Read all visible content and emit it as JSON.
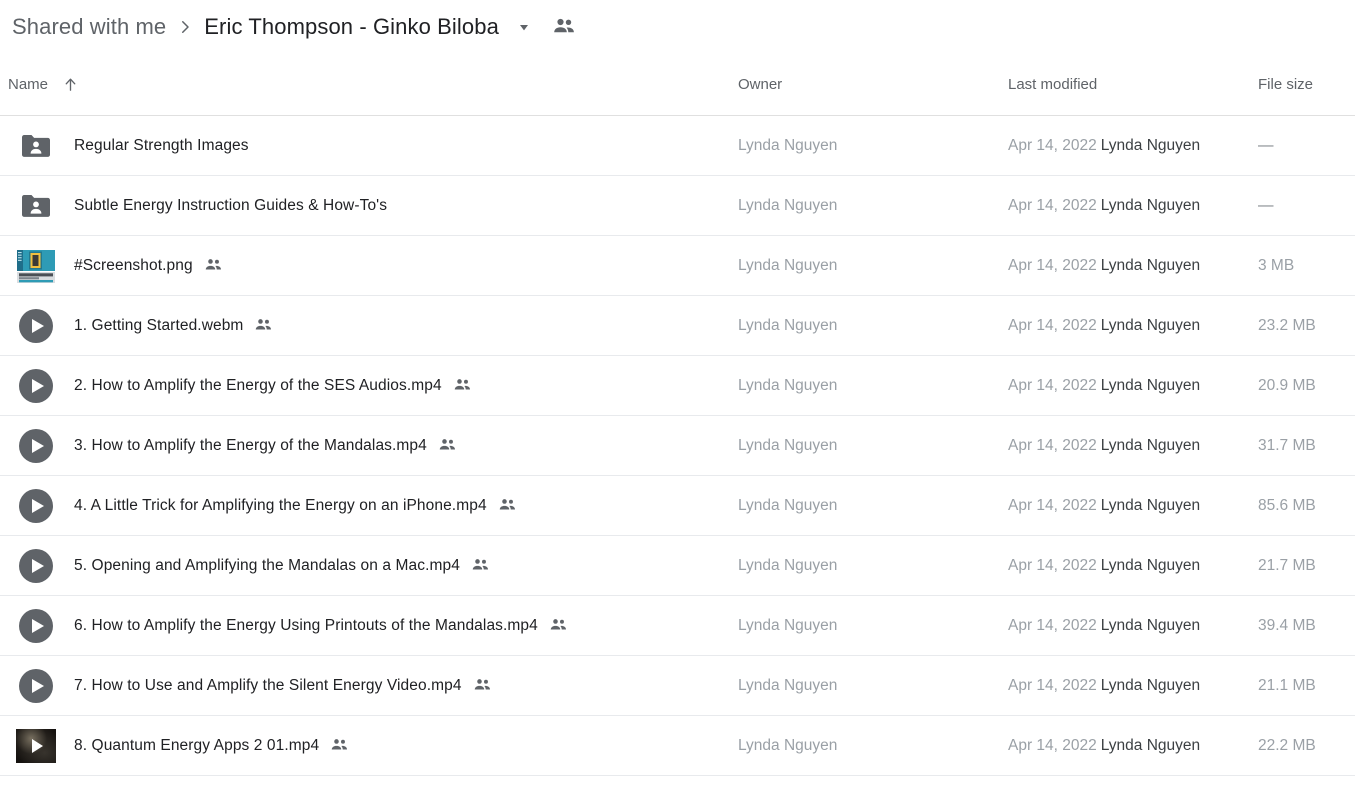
{
  "breadcrumb": {
    "root_label": "Shared with me",
    "separator": "chevron-right-icon",
    "current_label": "Eric Thompson - Ginko Biloba",
    "caret": "chevron-down-icon",
    "people": "people-shared-icon"
  },
  "columns": {
    "name": "Name",
    "sort_indicator": "arrow-up-icon",
    "owner": "Owner",
    "last_modified": "Last modified",
    "file_size": "File size"
  },
  "rows": [
    {
      "icon": "shared-folder-icon",
      "name": "Regular Strength Images",
      "shared": false,
      "owner": "Lynda Nguyen",
      "modified_date": "Apr 14, 2022",
      "modified_by": "Lynda Nguyen",
      "size": "—"
    },
    {
      "icon": "shared-folder-icon",
      "name": "Subtle Energy Instruction Guides & How-To's",
      "shared": false,
      "owner": "Lynda Nguyen",
      "modified_date": "Apr 14, 2022",
      "modified_by": "Lynda Nguyen",
      "size": "—"
    },
    {
      "icon": "image-thumbnail-icon",
      "name": "#Screenshot.png",
      "shared": true,
      "owner": "Lynda Nguyen",
      "modified_date": "Apr 14, 2022",
      "modified_by": "Lynda Nguyen",
      "size": "3 MB"
    },
    {
      "icon": "video-play-icon",
      "name": "1. Getting Started.webm",
      "shared": true,
      "owner": "Lynda Nguyen",
      "modified_date": "Apr 14, 2022",
      "modified_by": "Lynda Nguyen",
      "size": "23.2 MB"
    },
    {
      "icon": "video-play-icon",
      "name": "2. How to Amplify the Energy of the SES Audios.mp4",
      "shared": true,
      "owner": "Lynda Nguyen",
      "modified_date": "Apr 14, 2022",
      "modified_by": "Lynda Nguyen",
      "size": "20.9 MB"
    },
    {
      "icon": "video-play-icon",
      "name": "3. How to Amplify the Energy of the Mandalas.mp4",
      "shared": true,
      "owner": "Lynda Nguyen",
      "modified_date": "Apr 14, 2022",
      "modified_by": "Lynda Nguyen",
      "size": "31.7 MB"
    },
    {
      "icon": "video-play-icon",
      "name": "4. A Little Trick for Amplifying the Energy on an iPhone.mp4",
      "shared": true,
      "owner": "Lynda Nguyen",
      "modified_date": "Apr 14, 2022",
      "modified_by": "Lynda Nguyen",
      "size": "85.6 MB"
    },
    {
      "icon": "video-play-icon",
      "name": "5. Opening and Amplifying the Mandalas on a Mac.mp4",
      "shared": true,
      "owner": "Lynda Nguyen",
      "modified_date": "Apr 14, 2022",
      "modified_by": "Lynda Nguyen",
      "size": "21.7 MB"
    },
    {
      "icon": "video-play-icon",
      "name": "6. How to Amplify the Energy Using Printouts of the Mandalas.mp4",
      "shared": true,
      "owner": "Lynda Nguyen",
      "modified_date": "Apr 14, 2022",
      "modified_by": "Lynda Nguyen",
      "size": "39.4 MB"
    },
    {
      "icon": "video-play-icon",
      "name": "7. How to Use and Amplify the Silent Energy Video.mp4",
      "shared": true,
      "owner": "Lynda Nguyen",
      "modified_date": "Apr 14, 2022",
      "modified_by": "Lynda Nguyen",
      "size": "21.1 MB"
    },
    {
      "icon": "video-thumbnail-icon",
      "name": "8. Quantum Energy Apps 2 01.mp4",
      "shared": true,
      "owner": "Lynda Nguyen",
      "modified_date": "Apr 14, 2022",
      "modified_by": "Lynda Nguyen",
      "size": "22.2 MB"
    }
  ],
  "colors": {
    "text_primary": "#202124",
    "text_secondary": "#5f6368",
    "text_muted": "#9aa0a6",
    "divider": "#e8eaed",
    "folder_icon": "#5f6368",
    "background": "#ffffff"
  }
}
